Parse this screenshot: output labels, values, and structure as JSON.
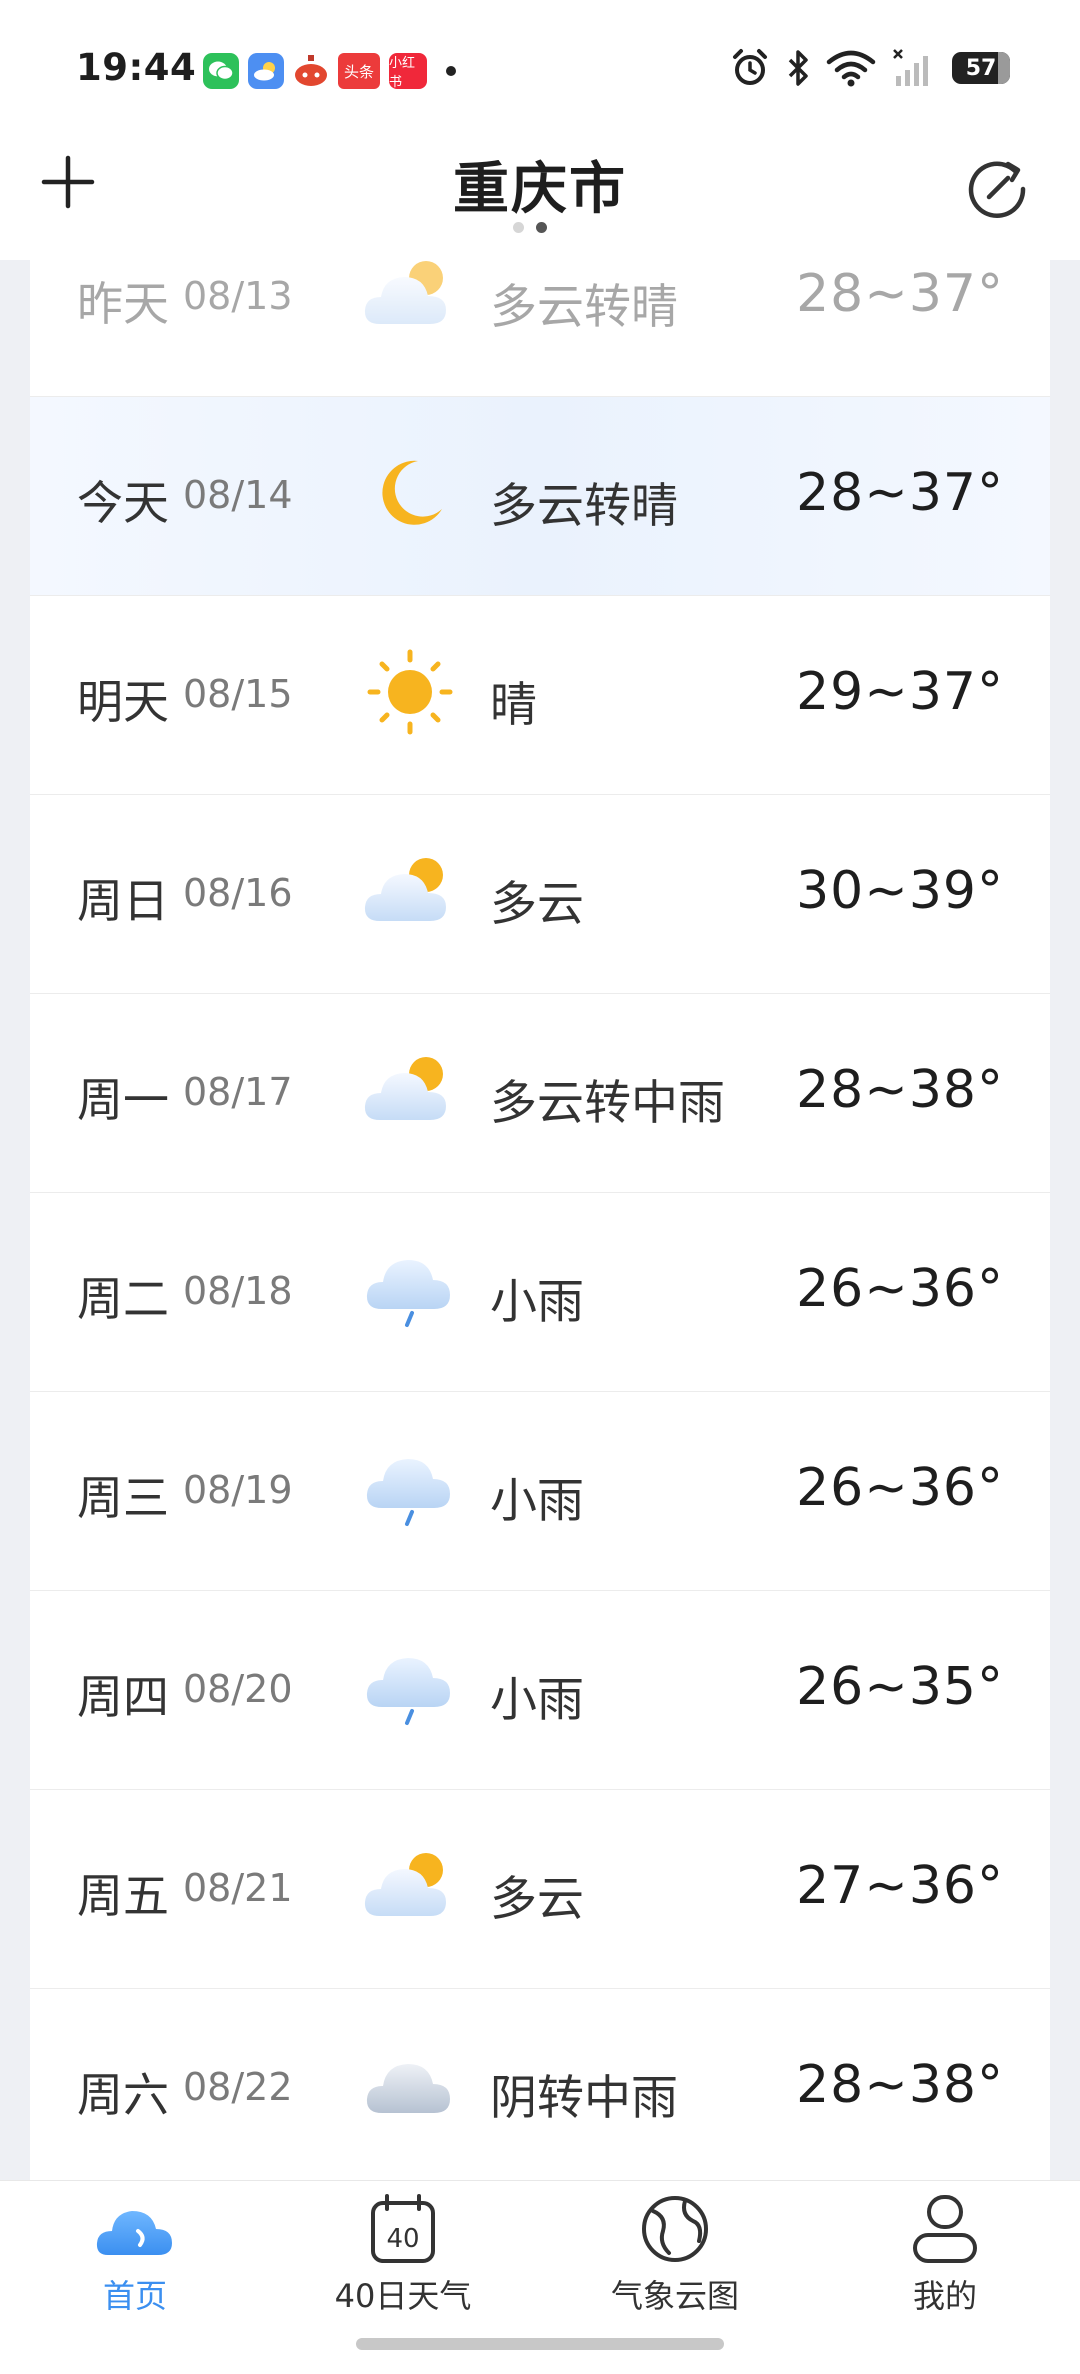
{
  "status_bar": {
    "time": "19:44",
    "app_icons": [
      "wechat-icon",
      "weather-app-icon",
      "lantern-app-icon",
      "toutiao-icon",
      "xiaohongshu-icon"
    ],
    "toutiao_label": "头条",
    "xiaohongshu_label": "小红书",
    "battery": "57"
  },
  "header": {
    "city": "重庆市",
    "page_count": 2,
    "active_page": 2
  },
  "forecast": [
    {
      "day": "昨天",
      "date": "08/13",
      "icon": "partly-cloudy-icon",
      "condition": "多云转晴",
      "temp": "28~37°",
      "past": true
    },
    {
      "day": "今天",
      "date": "08/14",
      "icon": "moon-icon",
      "condition": "多云转晴",
      "temp": "28~37°",
      "today": true
    },
    {
      "day": "明天",
      "date": "08/15",
      "icon": "sun-icon",
      "condition": "晴",
      "temp": "29~37°"
    },
    {
      "day": "周日",
      "date": "08/16",
      "icon": "partly-cloudy-icon",
      "condition": "多云",
      "temp": "30~39°"
    },
    {
      "day": "周一",
      "date": "08/17",
      "icon": "partly-cloudy-icon",
      "condition": "多云转中雨",
      "temp": "28~38°"
    },
    {
      "day": "周二",
      "date": "08/18",
      "icon": "light-rain-icon",
      "condition": "小雨",
      "temp": "26~36°"
    },
    {
      "day": "周三",
      "date": "08/19",
      "icon": "light-rain-icon",
      "condition": "小雨",
      "temp": "26~36°"
    },
    {
      "day": "周四",
      "date": "08/20",
      "icon": "light-rain-icon",
      "condition": "小雨",
      "temp": "26~35°"
    },
    {
      "day": "周五",
      "date": "08/21",
      "icon": "partly-cloudy-icon",
      "condition": "多云",
      "temp": "27~36°"
    },
    {
      "day": "周六",
      "date": "08/22",
      "icon": "overcast-icon",
      "condition": "阴转中雨",
      "temp": "28~38°"
    }
  ],
  "bottom_nav": {
    "home": "首页",
    "forty_day_label": "40日天气",
    "forty_day_icon_text": "40",
    "satellite": "气象云图",
    "me": "我的",
    "active": "home"
  },
  "colors": {
    "accent": "#3b8ff0",
    "sun": "#f7b41f",
    "cloud": "#dbe8f8",
    "rain": "#4a8fe0"
  }
}
